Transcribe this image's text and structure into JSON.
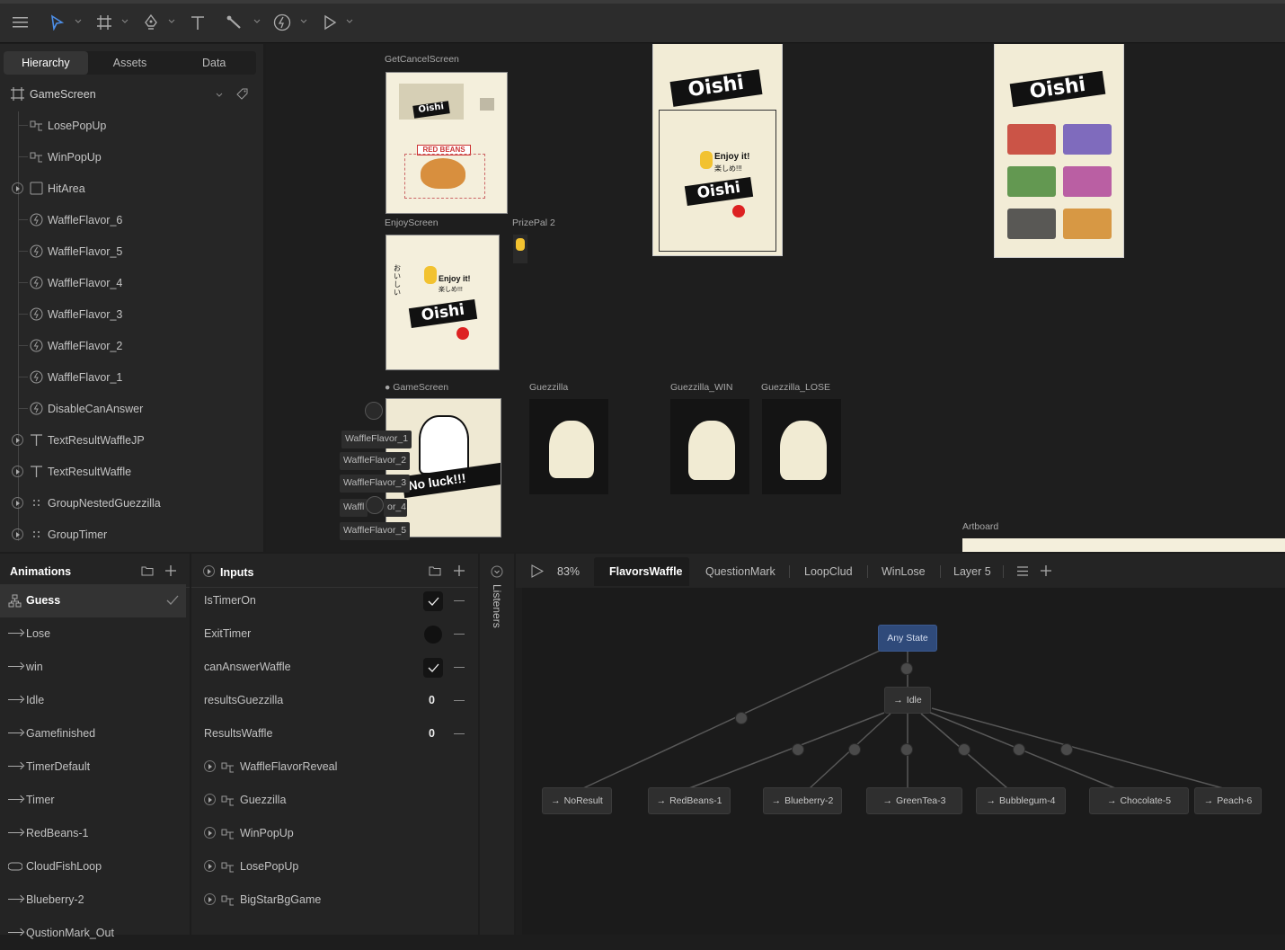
{
  "toolbar": {
    "icons": [
      "menu-icon",
      "select-icon",
      "frame-icon",
      "pen-icon",
      "text-icon",
      "bone-icon",
      "event-icon",
      "play-icon"
    ]
  },
  "hierarchy": {
    "tabs": [
      "Hierarchy",
      "Assets",
      "Data"
    ],
    "root": "GameScreen",
    "items": [
      {
        "label": "LosePopUp",
        "icon": "group-icon"
      },
      {
        "label": "WinPopUp",
        "icon": "group-icon"
      },
      {
        "label": "HitArea",
        "icon": "shape-icon",
        "expandable": true
      },
      {
        "label": "WaffleFlavor_6",
        "icon": "event-icon"
      },
      {
        "label": "WaffleFlavor_5",
        "icon": "event-icon"
      },
      {
        "label": "WaffleFlavor_4",
        "icon": "event-icon"
      },
      {
        "label": "WaffleFlavor_3",
        "icon": "event-icon"
      },
      {
        "label": "WaffleFlavor_2",
        "icon": "event-icon"
      },
      {
        "label": "WaffleFlavor_1",
        "icon": "event-icon"
      },
      {
        "label": "DisableCanAnswer",
        "icon": "event-icon"
      },
      {
        "label": "TextResultWaffleJP",
        "icon": "text-icon",
        "expandable": true
      },
      {
        "label": "TextResultWaffle",
        "icon": "text-icon",
        "expandable": true
      },
      {
        "label": "GroupNestedGuezzilla",
        "icon": "grid-icon",
        "expandable": true
      },
      {
        "label": "GroupTimer",
        "icon": "grid-icon",
        "expandable": true
      }
    ]
  },
  "canvas": {
    "labels": {
      "get_cancel": "GetCancelScreen",
      "enjoy": "EnjoyScreen",
      "prizepal": "PrizePal 2",
      "gamescreen": "GameScreen",
      "guezzilla": "Guezzilla",
      "guezzilla_win": "Guezzilla_WIN",
      "guezzilla_lose": "Guezzilla_LOSE",
      "artboard": "Artboard"
    },
    "art_text": {
      "oishi": "Oishi",
      "enjoy": "Enjoy it!",
      "enjoy_jp": "楽しめ!!!",
      "red_beans": "RED BEANS",
      "no_luck": "No luck!!!",
      "vertical_jp": "おいしい"
    },
    "overlays": [
      "WaffleFlavor_1",
      "WaffleFlavor_2",
      "WaffleFlavor_3",
      "Waffl",
      "or_4",
      "WaffleFlavor_5"
    ]
  },
  "animations": {
    "title": "Animations",
    "items": [
      {
        "label": "Guess",
        "selected": true
      },
      {
        "label": "Lose"
      },
      {
        "label": "win"
      },
      {
        "label": "Idle"
      },
      {
        "label": "Gamefinished"
      },
      {
        "label": "TimerDefault"
      },
      {
        "label": "Timer"
      },
      {
        "label": "RedBeans-1"
      },
      {
        "label": "CloudFishLoop"
      },
      {
        "label": "Blueberry-2"
      },
      {
        "label": "QustionMark_Out"
      }
    ]
  },
  "inputs": {
    "title": "Inputs",
    "items": [
      {
        "label": "IsTimerOn",
        "type": "bool",
        "checked": true
      },
      {
        "label": "ExitTimer",
        "type": "trigger"
      },
      {
        "label": "canAnswerWaffle",
        "type": "bool",
        "checked": true
      },
      {
        "label": "resultsGuezzilla",
        "type": "number",
        "value": "0"
      },
      {
        "label": "ResultsWaffle",
        "type": "number",
        "value": "0"
      }
    ],
    "nested": [
      "WaffleFlavorReveal",
      "Guezzilla",
      "WinPopUp",
      "LosePopUp",
      "BigStarBgGame"
    ]
  },
  "listeners": {
    "title": "Listeners"
  },
  "graph": {
    "zoom": "83%",
    "tabs": [
      "FlavorsWaffle",
      "QuestionMark",
      "LoopClud",
      "WinLose",
      "Layer 5"
    ],
    "active_tab": "FlavorsWaffle",
    "any_state": "Any State",
    "idle": "Idle",
    "nodes": [
      "NoResult",
      "RedBeans-1",
      "Blueberry-2",
      "GreenTea-3",
      "Bubblegum-4",
      "Chocolate-5",
      "Peach-6"
    ]
  },
  "colors": {
    "accent": "#2f4a7a",
    "canvas": "#1e1e1e",
    "panel": "#262626",
    "cream": "#f4efdc"
  }
}
